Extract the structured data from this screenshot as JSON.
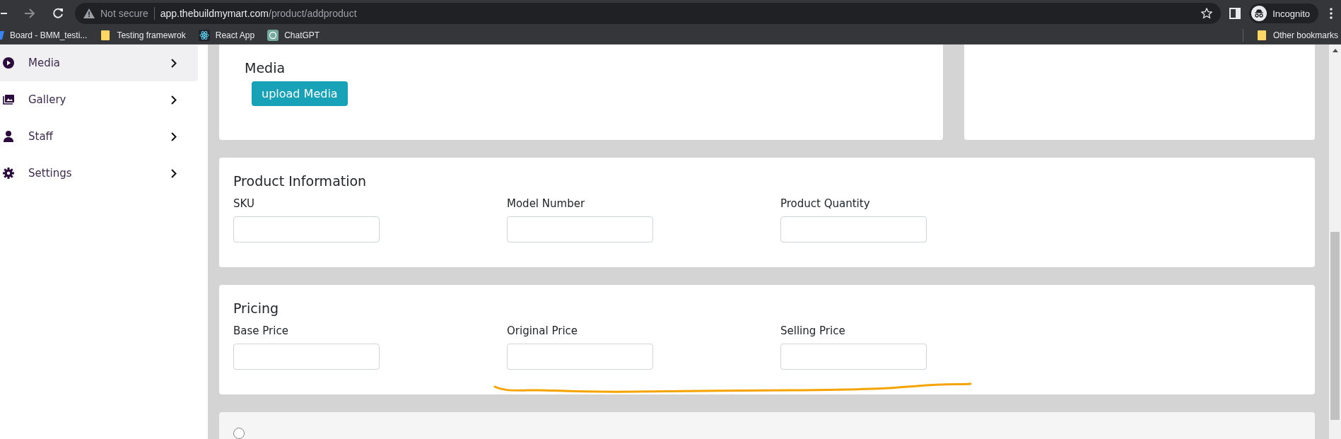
{
  "browser": {
    "security": "Not secure",
    "url_host": "app.thebuildmymart.com",
    "url_path": "/product/addproduct",
    "profile": "Incognito",
    "bookmarks": [
      {
        "label": "Board - BMM_testi...",
        "kind": "board"
      },
      {
        "label": "Testing framewrok",
        "kind": "folder"
      },
      {
        "label": "React App",
        "kind": "react"
      },
      {
        "label": "ChatGPT",
        "kind": "chat"
      }
    ],
    "other_bookmarks": "Other bookmarks"
  },
  "sidebar": {
    "items": [
      {
        "label": "Media",
        "selected": true
      },
      {
        "label": "Gallery",
        "selected": false
      },
      {
        "label": "Staff",
        "selected": false
      },
      {
        "label": "Settings",
        "selected": false
      }
    ]
  },
  "media": {
    "title": "Media",
    "button": "upload Media"
  },
  "sections": [
    {
      "title": "Product Information",
      "fields": [
        {
          "label": "SKU"
        },
        {
          "label": "Model Number"
        },
        {
          "label": "Product Quantity"
        }
      ]
    },
    {
      "title": "Pricing",
      "fields": [
        {
          "label": "Base Price"
        },
        {
          "label": "Original Price"
        },
        {
          "label": "Selling Price"
        }
      ]
    }
  ],
  "product_type": {
    "checked": false
  }
}
